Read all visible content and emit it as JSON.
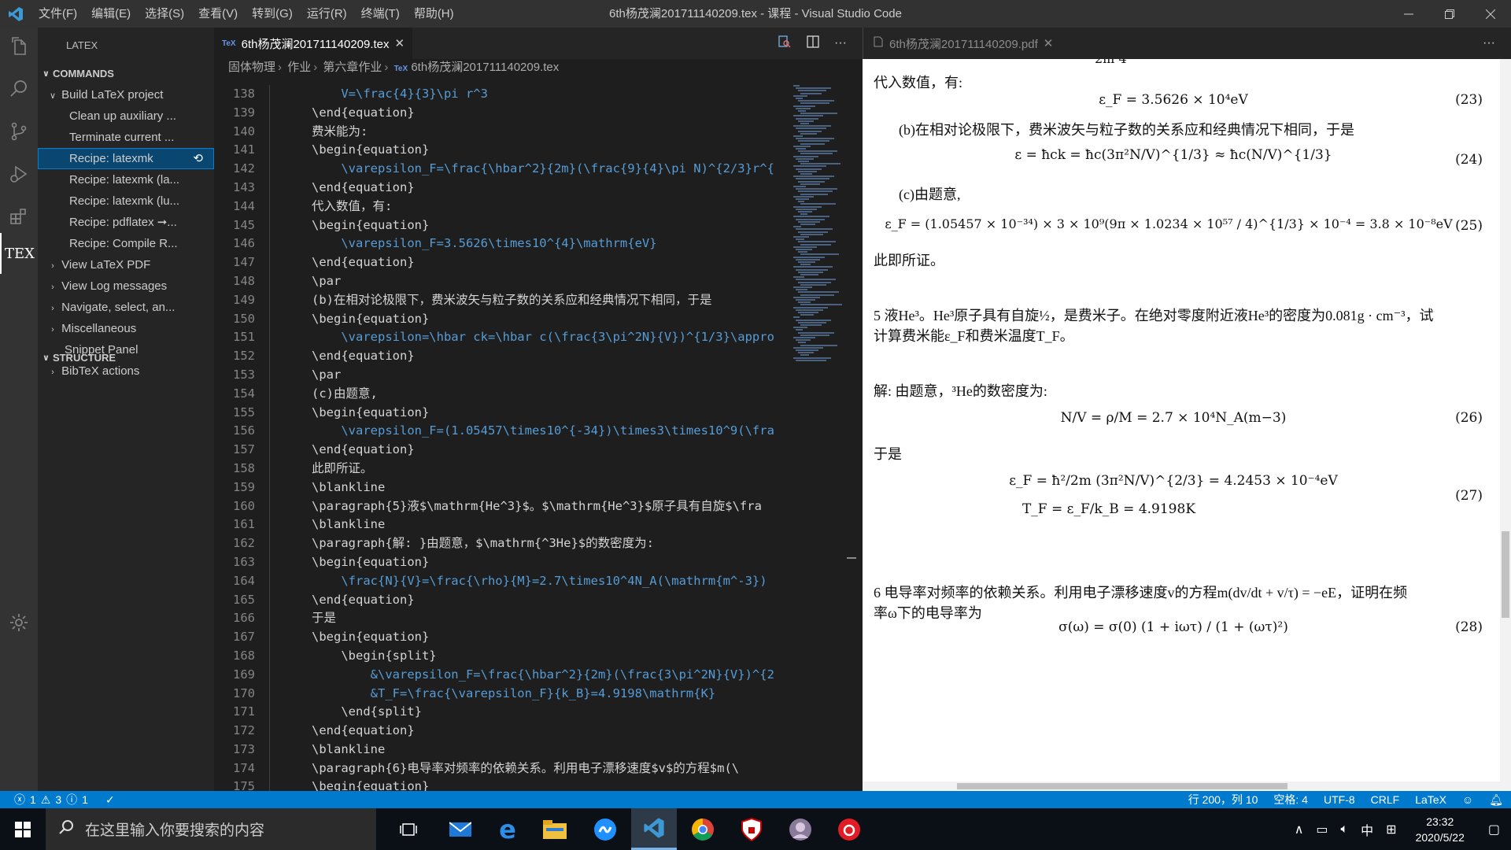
{
  "window": {
    "title": "6th杨茂澜201711140209.tex - 课程 - Visual Studio Code",
    "menu": [
      "文件(F)",
      "编辑(E)",
      "选择(S)",
      "查看(V)",
      "转到(G)",
      "运行(R)",
      "终端(T)",
      "帮助(H)"
    ]
  },
  "activity": {
    "icons": [
      "files-icon",
      "search-icon",
      "source-control-icon",
      "run-debug-icon",
      "extensions-icon",
      "tex-icon",
      "settings-icon"
    ],
    "tex_label": "TEX"
  },
  "sidebar": {
    "title": "LATEX",
    "commands_header": "COMMANDS",
    "structure_header": "STRUCTURE",
    "items": [
      {
        "label": "Build LaTeX project",
        "indent": 1,
        "twisty": "open"
      },
      {
        "label": "Clean up auxiliary ...",
        "indent": 2
      },
      {
        "label": "Terminate current ...",
        "indent": 2
      },
      {
        "label": "Recipe: latexmk",
        "indent": 2,
        "selected": true
      },
      {
        "label": "Recipe: latexmk (la...",
        "indent": 2
      },
      {
        "label": "Recipe: latexmk (lu...",
        "indent": 2
      },
      {
        "label": "Recipe: pdflatex ➞...",
        "indent": 2
      },
      {
        "label": "Recipe: Compile R...",
        "indent": 2
      },
      {
        "label": "View LaTeX PDF",
        "indent": 1,
        "twisty": "closed"
      },
      {
        "label": "View Log messages",
        "indent": 1,
        "twisty": "closed"
      },
      {
        "label": "Navigate, select, an...",
        "indent": 1,
        "twisty": "closed"
      },
      {
        "label": "Miscellaneous",
        "indent": 1,
        "twisty": "closed"
      },
      {
        "label": "Snippet Panel",
        "indent": 1
      },
      {
        "label": "BibTeX actions",
        "indent": 1,
        "twisty": "closed"
      }
    ]
  },
  "editor": {
    "tab_label": "6th杨茂澜201711140209.tex",
    "tex_badge": "TeX",
    "breadcrumb": [
      "固体物理",
      "作业",
      "第六章作业",
      "6th杨茂澜201711140209.tex"
    ],
    "lines": [
      {
        "n": "138",
        "t": "    V=\\frac{4}{3}\\pi r^3"
      },
      {
        "n": "139",
        "t": "\\end{equation}"
      },
      {
        "n": "140",
        "t": "费米能为:"
      },
      {
        "n": "141",
        "t": "\\begin{equation}"
      },
      {
        "n": "142",
        "t": "    \\varepsilon_F=\\frac{\\hbar^2}{2m}(\\frac{9}{4}\\pi N)^{2/3}r^{"
      },
      {
        "n": "143",
        "t": "\\end{equation}"
      },
      {
        "n": "144",
        "t": "代入数值，有:"
      },
      {
        "n": "145",
        "t": "\\begin{equation}"
      },
      {
        "n": "146",
        "t": "    \\varepsilon_F=3.5626\\times10^{4}\\mathrm{eV}"
      },
      {
        "n": "147",
        "t": "\\end{equation}"
      },
      {
        "n": "148",
        "t": "\\par"
      },
      {
        "n": "149",
        "t": "(b)在相对论极限下，费米波矢与粒子数的关系应和经典情况下相同，于是"
      },
      {
        "n": "150",
        "t": "\\begin{equation}"
      },
      {
        "n": "151",
        "t": "    \\varepsilon=\\hbar ck=\\hbar c(\\frac{3\\pi^2N}{V})^{1/3}\\appro"
      },
      {
        "n": "152",
        "t": "\\end{equation}"
      },
      {
        "n": "153",
        "t": "\\par"
      },
      {
        "n": "154",
        "t": "(c)由题意,"
      },
      {
        "n": "155",
        "t": "\\begin{equation}"
      },
      {
        "n": "156",
        "t": "    \\varepsilon_F=(1.05457\\times10^{-34})\\times3\\times10^9(\\fra"
      },
      {
        "n": "157",
        "t": "\\end{equation}"
      },
      {
        "n": "158",
        "t": "此即所证。"
      },
      {
        "n": "159",
        "t": "\\blankline"
      },
      {
        "n": "160",
        "t": "\\paragraph{5}液$\\mathrm{He^3}$。$\\mathrm{He^3}$原子具有自旋$\\fra"
      },
      {
        "n": "161",
        "t": "\\blankline"
      },
      {
        "n": "162",
        "t": "\\paragraph{解: }由题意，$\\mathrm{^3He}$的数密度为:"
      },
      {
        "n": "163",
        "t": "\\begin{equation}"
      },
      {
        "n": "164",
        "t": "    \\frac{N}{V}=\\frac{\\rho}{M}=2.7\\times10^4N_A(\\mathrm{m^-3})"
      },
      {
        "n": "165",
        "t": "\\end{equation}"
      },
      {
        "n": "166",
        "t": "于是"
      },
      {
        "n": "167",
        "t": "\\begin{equation}"
      },
      {
        "n": "168",
        "t": "    \\begin{split}"
      },
      {
        "n": "169",
        "t": "        &\\varepsilon_F=\\frac{\\hbar^2}{2m}(\\frac{3\\pi^2N}{V})^{2"
      },
      {
        "n": "170",
        "t": "        &T_F=\\frac{\\varepsilon_F}{k_B}=4.9198\\mathrm{K}"
      },
      {
        "n": "171",
        "t": "    \\end{split}"
      },
      {
        "n": "172",
        "t": "\\end{equation}"
      },
      {
        "n": "173",
        "t": "\\blankline"
      },
      {
        "n": "174",
        "t": "\\paragraph{6}电导率对频率的依赖关系。利用电子漂移速度$v$的方程$m(\\"
      },
      {
        "n": "175",
        "t": "\\begin{equation}"
      }
    ]
  },
  "pdf": {
    "tab_label": "6th杨茂澜201711140209.pdf",
    "texts": {
      "top": "2m  4",
      "p1": "代入数值，有:",
      "e23": "ε_F = 3.5626 × 10⁴eV",
      "p2": "(b)在相对论极限下，费米波矢与粒子数的关系应和经典情况下相同，于是",
      "e24": "ε = ħck = ħc(3π²N/V)^{1/3} ≈ ħc(N/V)^{1/3}",
      "p3": "(c)由题意,",
      "e25": "ε_F = (1.05457 × 10⁻³⁴) × 3 × 10⁹(9π × 1.0234 × 10⁵⁷ / 4)^{1/3} × 10⁻⁴ = 3.8 × 10⁻⁸eV",
      "p4": "此即所证。",
      "p5a": "5   液He³。He³原子具有自旋½，是费米子。在绝对零度附近液He³的密度为0.081g · cm⁻³，试",
      "p5b": "计算费米能ε_F和费米温度T_F。",
      "p6": "解:   由题意，³He的数密度为:",
      "e26": "N/V = ρ/M = 2.7 × 10⁴N_A(m−3)",
      "p7": "于是",
      "e27a": "ε_F = ħ²/2m (3π²N/V)^{2/3} = 4.2453 × 10⁻⁴eV",
      "e27b": "T_F = ε_F/k_B = 4.9198K",
      "p8a": "6   电导率对频率的依赖关系。利用电子漂移速度v的方程m(dv/dt + v/τ) = −eE，证明在频",
      "p8b": "率ω下的电导率为",
      "e28": "σ(ω) = σ(0) (1 + iωτ) / (1 + (ωτ)²)"
    },
    "eqno": {
      "e23": "(23)",
      "e24": "(24)",
      "e25": "(25)",
      "e26": "(26)",
      "e27": "(27)",
      "e28": "(28)"
    }
  },
  "status": {
    "errors": "1",
    "warnings": "3",
    "infos": "1",
    "position": "行 200，列 10",
    "spaces": "空格: 4",
    "encoding": "UTF-8",
    "eol": "CRLF",
    "language": "LaTeX"
  },
  "taskbar": {
    "search_placeholder": "在这里输入你要搜索的内容",
    "ime": "中",
    "time": "23:32",
    "date": "2020/5/22",
    "apps": [
      "task-view-icon",
      "mail-icon",
      "edge-icon",
      "file-explorer-icon",
      "baidu-netdisk-icon",
      "vscode-icon",
      "chrome-icon",
      "security-icon",
      "avatar-app-icon",
      "netease-music-icon"
    ]
  },
  "colors": {
    "accent": "#007acc",
    "selection": "#094771",
    "keyword": "#569cd6"
  }
}
